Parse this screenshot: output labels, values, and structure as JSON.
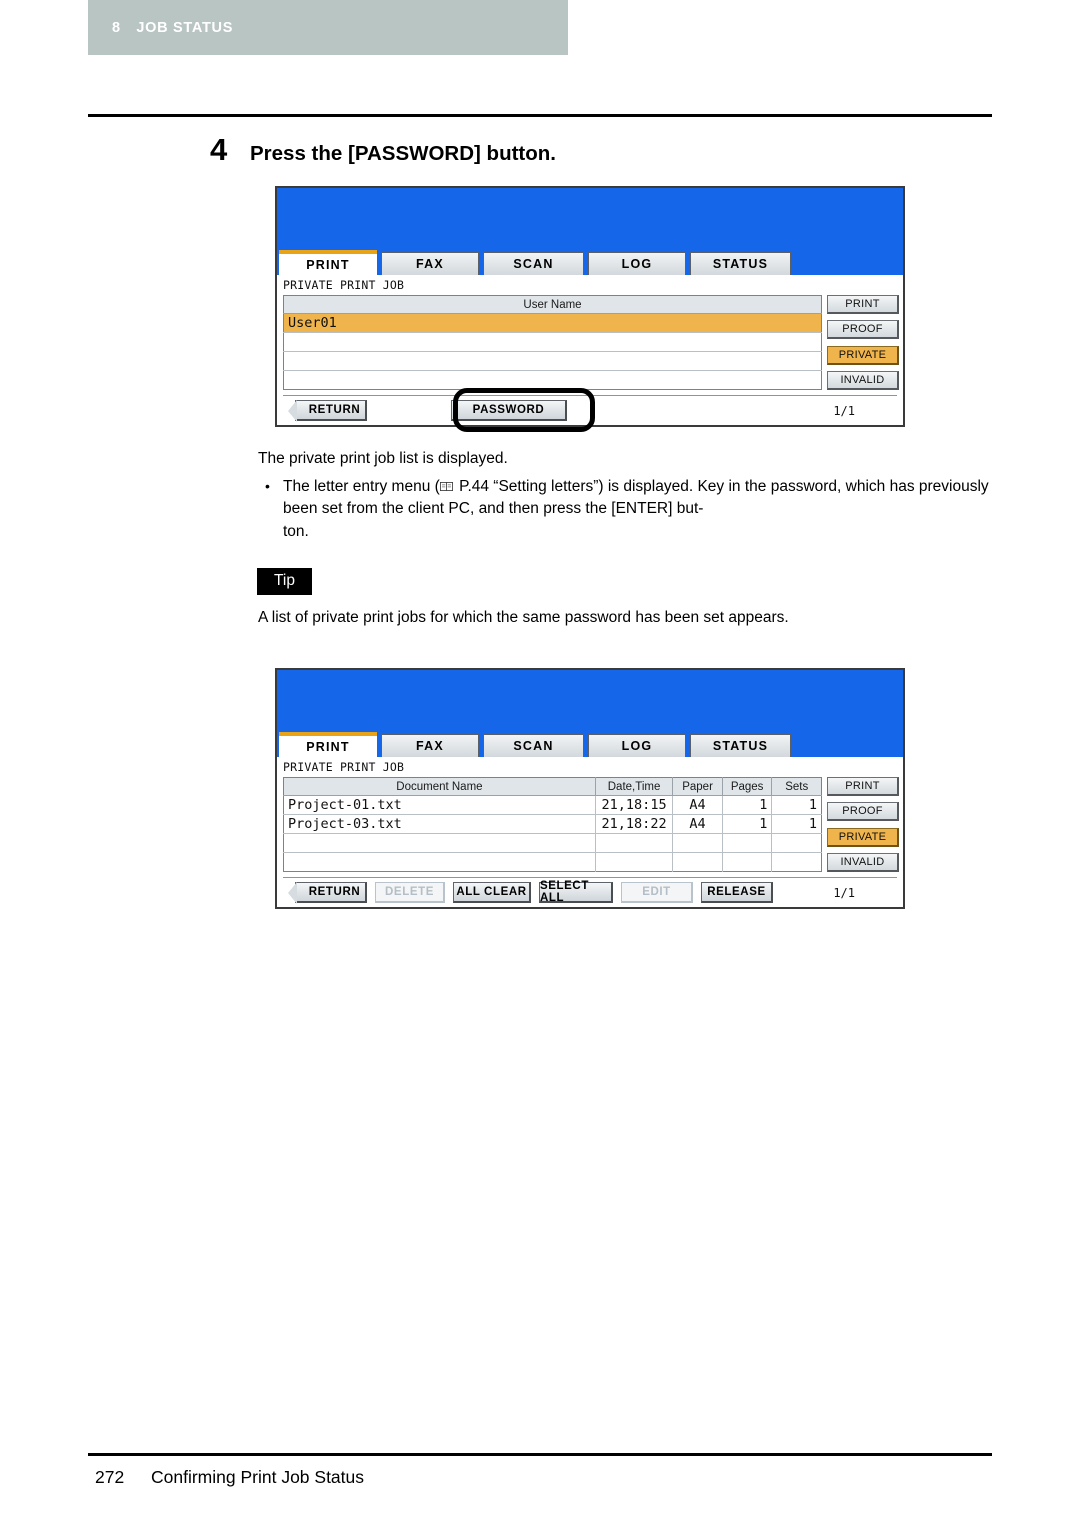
{
  "running_head": {
    "chapter_number": "8",
    "chapter_title": "JOB STATUS"
  },
  "step": {
    "number": "4",
    "title": "Press the [PASSWORD] button."
  },
  "panel_user": {
    "tabs": [
      {
        "label": "PRINT",
        "active": true
      },
      {
        "label": "FAX",
        "active": false
      },
      {
        "label": "SCAN",
        "active": false
      },
      {
        "label": "LOG",
        "active": false
      },
      {
        "label": "STATUS",
        "active": false
      }
    ],
    "screen_label": "PRIVATE PRINT JOB",
    "columns": [
      "User Name"
    ],
    "rows": [
      {
        "user_name": "User01",
        "selected": true
      },
      {
        "user_name": "",
        "selected": false
      },
      {
        "user_name": "",
        "selected": false
      },
      {
        "user_name": "",
        "selected": false
      }
    ],
    "side_buttons": [
      {
        "label": "PRINT",
        "active": false
      },
      {
        "label": "PROOF",
        "active": false
      },
      {
        "label": "PRIVATE",
        "active": true
      },
      {
        "label": "INVALID",
        "active": false
      }
    ],
    "footer_buttons": [
      {
        "label": "RETURN",
        "disabled": false
      },
      {
        "label": "PASSWORD",
        "disabled": false
      }
    ],
    "page_indicator": "1/1"
  },
  "caption_1": "The private print job list is displayed.",
  "bullet_1": {
    "bullet": "•",
    "part_a": "The letter entry menu (",
    "icon": "book-icon",
    "part_b": " P.44 “Setting letters”) is displayed. Key in the password, which has previously been set from the client PC, and then press the [ENTER] but-",
    "part_c": "ton."
  },
  "tip": {
    "label": "Tip",
    "text": "A list of private print jobs for which the same password has been set appears."
  },
  "panel_docs": {
    "tabs": [
      {
        "label": "PRINT",
        "active": true
      },
      {
        "label": "FAX",
        "active": false
      },
      {
        "label": "SCAN",
        "active": false
      },
      {
        "label": "LOG",
        "active": false
      },
      {
        "label": "STATUS",
        "active": false
      }
    ],
    "screen_label": "PRIVATE PRINT JOB",
    "columns": [
      "Document Name",
      "Date,Time",
      "Paper",
      "Pages",
      "Sets"
    ],
    "rows": [
      {
        "doc": "Project-01.txt",
        "date": "21,18:15",
        "paper": "A4",
        "pages": "1",
        "sets": "1"
      },
      {
        "doc": "Project-03.txt",
        "date": "21,18:22",
        "paper": "A4",
        "pages": "1",
        "sets": "1"
      },
      {
        "doc": "",
        "date": "",
        "paper": "",
        "pages": "",
        "sets": ""
      },
      {
        "doc": "",
        "date": "",
        "paper": "",
        "pages": "",
        "sets": ""
      }
    ],
    "side_buttons": [
      {
        "label": "PRINT",
        "active": false
      },
      {
        "label": "PROOF",
        "active": false
      },
      {
        "label": "PRIVATE",
        "active": true
      },
      {
        "label": "INVALID",
        "active": false
      }
    ],
    "footer_buttons": [
      {
        "label": "RETURN",
        "disabled": false
      },
      {
        "label": "DELETE",
        "disabled": true
      },
      {
        "label": "ALL CLEAR",
        "disabled": false
      },
      {
        "label": "SELECT ALL",
        "disabled": false
      },
      {
        "label": "EDIT",
        "disabled": true
      },
      {
        "label": "RELEASE",
        "disabled": false
      }
    ],
    "page_indicator": "1/1"
  },
  "footer": {
    "page_number": "272",
    "section_title": "Confirming Print Job Status"
  },
  "colors": {
    "header_band": "#b9c5c3",
    "panel_blue": "#1566e8",
    "accent_orange": "#f0b44c",
    "tab_accent": "#e8a317"
  }
}
